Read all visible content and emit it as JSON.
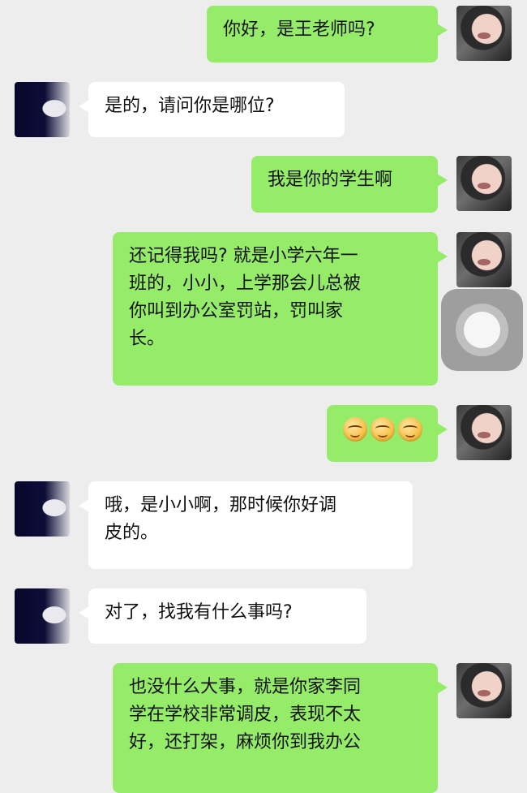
{
  "messages": [
    {
      "sender": "me",
      "text": "你好，是王老师吗?"
    },
    {
      "sender": "them",
      "text": "是的，请问你是哪位?"
    },
    {
      "sender": "me",
      "text": "我是你的学生啊"
    },
    {
      "sender": "me",
      "lines": [
        "还记得我吗? 就是小学六年一",
        "班的，小小，上学那会儿总被",
        "你叫到办公室罚站，罚叫家",
        "长。"
      ]
    },
    {
      "sender": "me",
      "emoji": [
        "smile-emoji",
        "smile-emoji",
        "smile-emoji"
      ]
    },
    {
      "sender": "them",
      "lines": [
        "哦，是小小啊，那时候你好调",
        "皮的。"
      ]
    },
    {
      "sender": "them",
      "text": "对了，找我有什么事吗?"
    },
    {
      "sender": "me",
      "lines": [
        "也没什么大事，就是你家李同",
        "学在学校非常调皮，表现不太",
        "好，还打架，麻烦你到我办公"
      ]
    }
  ],
  "colors": {
    "background": "#ededed",
    "my_bubble": "#95ec69",
    "their_bubble": "#ffffff"
  }
}
